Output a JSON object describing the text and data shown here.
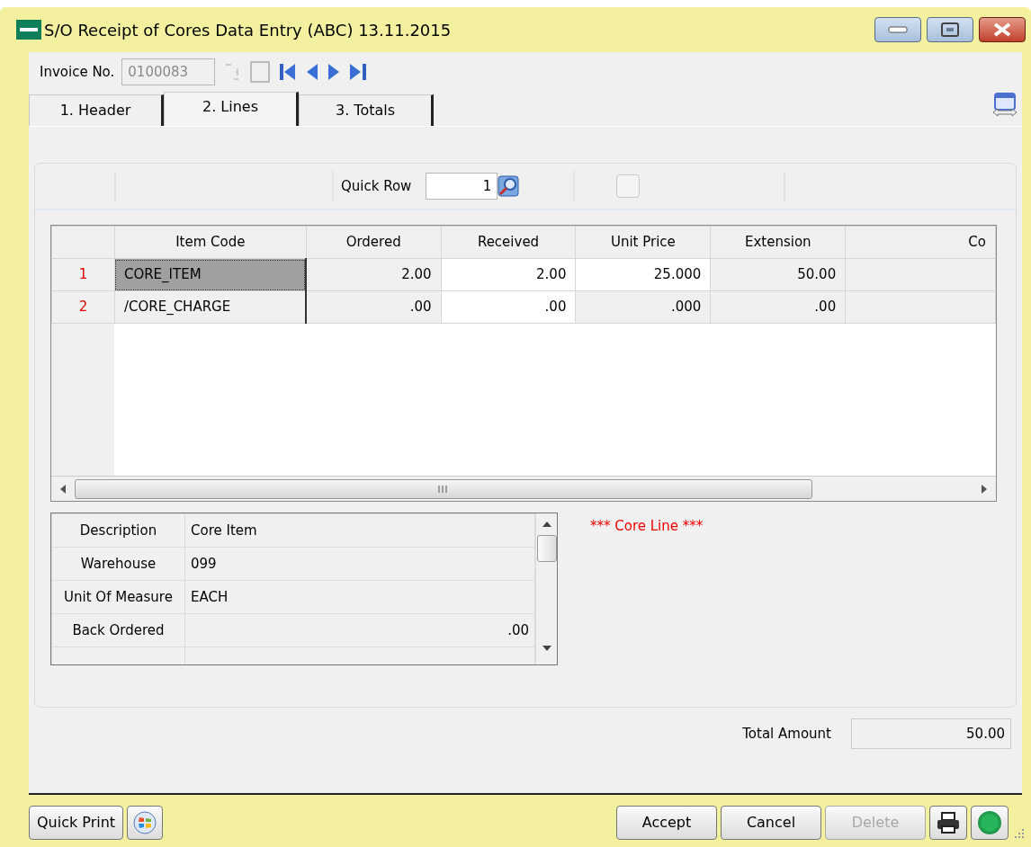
{
  "window": {
    "title": "S/O Receipt of Cores Data Entry (ABC) 13.11.2015"
  },
  "invoice": {
    "label": "Invoice No.",
    "value": "0100083",
    "disabled": true
  },
  "tabs": [
    {
      "label": "1. Header",
      "selected": false
    },
    {
      "label": "2. Lines",
      "selected": true
    },
    {
      "label": "3. Totals",
      "selected": false
    }
  ],
  "quick_row": {
    "label": "Quick Row",
    "value": "1"
  },
  "toolbar_checkbox": {
    "checked": false,
    "disabled": true
  },
  "grid": {
    "columns": [
      "Item Code",
      "Ordered",
      "Received",
      "Unit Price",
      "Extension",
      "Co"
    ],
    "rows": [
      {
        "number": "1",
        "selected": true,
        "cells": [
          {
            "text": "CORE_ITEM",
            "editable": false
          },
          {
            "text": "2.00",
            "editable": false
          },
          {
            "text": "2.00",
            "editable": true
          },
          {
            "text": "25.000",
            "editable": true
          },
          {
            "text": "50.00",
            "editable": false
          },
          {
            "text": "",
            "editable": false
          }
        ]
      },
      {
        "number": "2",
        "selected": false,
        "cells": [
          {
            "text": "/CORE_CHARGE",
            "editable": false
          },
          {
            "text": ".00",
            "editable": false
          },
          {
            "text": ".00",
            "editable": true
          },
          {
            "text": ".000",
            "editable": false
          },
          {
            "text": ".00",
            "editable": false
          },
          {
            "text": "",
            "editable": false
          }
        ]
      }
    ]
  },
  "details": [
    {
      "label": "Description",
      "value": "Core Item",
      "kind": "text"
    },
    {
      "label": "Warehouse",
      "value": "099",
      "kind": "text"
    },
    {
      "label": "Unit Of Measure",
      "value": "EACH",
      "kind": "text"
    },
    {
      "label": "Back Ordered",
      "value": ".00",
      "kind": "number"
    }
  ],
  "note": "*** Core Line ***",
  "total": {
    "label": "Total Amount",
    "value": "50.00"
  },
  "buttons_left": [
    {
      "label": "Quick Print",
      "kind": "text",
      "disabled": false
    },
    {
      "kind": "windows",
      "disabled": false
    }
  ],
  "buttons_right": [
    {
      "label": "Accept",
      "kind": "text",
      "disabled": false
    },
    {
      "label": "Cancel",
      "kind": "text",
      "disabled": false
    },
    {
      "label": "Delete",
      "kind": "text",
      "disabled": true
    },
    {
      "kind": "print",
      "disabled": false
    },
    {
      "kind": "help",
      "disabled": false
    }
  ]
}
